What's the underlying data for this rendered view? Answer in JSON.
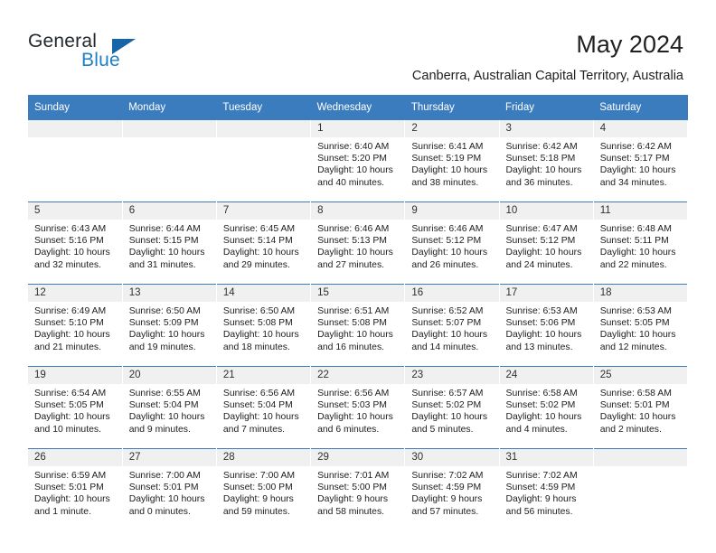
{
  "brand": {
    "word_one": "General",
    "word_two": "Blue",
    "triangle_icon": "triangle-icon",
    "accent_color": "#1f7fc4",
    "header_color": "#3b7cbf"
  },
  "header": {
    "title": "May 2024",
    "subtitle": "Canberra, Australian Capital Territory, Australia"
  },
  "calendar": {
    "weekday_headers": [
      "Sunday",
      "Monday",
      "Tuesday",
      "Wednesday",
      "Thursday",
      "Friday",
      "Saturday"
    ],
    "labels": {
      "sunrise": "Sunrise:",
      "sunset": "Sunset:",
      "daylight": "Daylight:"
    },
    "weeks": [
      [
        {
          "day": "",
          "empty": true
        },
        {
          "day": "",
          "empty": true
        },
        {
          "day": "",
          "empty": true
        },
        {
          "day": "1",
          "sunrise": "Sunrise: 6:40 AM",
          "sunset": "Sunset: 5:20 PM",
          "daylight": "Daylight: 10 hours and 40 minutes."
        },
        {
          "day": "2",
          "sunrise": "Sunrise: 6:41 AM",
          "sunset": "Sunset: 5:19 PM",
          "daylight": "Daylight: 10 hours and 38 minutes."
        },
        {
          "day": "3",
          "sunrise": "Sunrise: 6:42 AM",
          "sunset": "Sunset: 5:18 PM",
          "daylight": "Daylight: 10 hours and 36 minutes."
        },
        {
          "day": "4",
          "sunrise": "Sunrise: 6:42 AM",
          "sunset": "Sunset: 5:17 PM",
          "daylight": "Daylight: 10 hours and 34 minutes."
        }
      ],
      [
        {
          "day": "5",
          "sunrise": "Sunrise: 6:43 AM",
          "sunset": "Sunset: 5:16 PM",
          "daylight": "Daylight: 10 hours and 32 minutes."
        },
        {
          "day": "6",
          "sunrise": "Sunrise: 6:44 AM",
          "sunset": "Sunset: 5:15 PM",
          "daylight": "Daylight: 10 hours and 31 minutes."
        },
        {
          "day": "7",
          "sunrise": "Sunrise: 6:45 AM",
          "sunset": "Sunset: 5:14 PM",
          "daylight": "Daylight: 10 hours and 29 minutes."
        },
        {
          "day": "8",
          "sunrise": "Sunrise: 6:46 AM",
          "sunset": "Sunset: 5:13 PM",
          "daylight": "Daylight: 10 hours and 27 minutes."
        },
        {
          "day": "9",
          "sunrise": "Sunrise: 6:46 AM",
          "sunset": "Sunset: 5:12 PM",
          "daylight": "Daylight: 10 hours and 26 minutes."
        },
        {
          "day": "10",
          "sunrise": "Sunrise: 6:47 AM",
          "sunset": "Sunset: 5:12 PM",
          "daylight": "Daylight: 10 hours and 24 minutes."
        },
        {
          "day": "11",
          "sunrise": "Sunrise: 6:48 AM",
          "sunset": "Sunset: 5:11 PM",
          "daylight": "Daylight: 10 hours and 22 minutes."
        }
      ],
      [
        {
          "day": "12",
          "sunrise": "Sunrise: 6:49 AM",
          "sunset": "Sunset: 5:10 PM",
          "daylight": "Daylight: 10 hours and 21 minutes."
        },
        {
          "day": "13",
          "sunrise": "Sunrise: 6:50 AM",
          "sunset": "Sunset: 5:09 PM",
          "daylight": "Daylight: 10 hours and 19 minutes."
        },
        {
          "day": "14",
          "sunrise": "Sunrise: 6:50 AM",
          "sunset": "Sunset: 5:08 PM",
          "daylight": "Daylight: 10 hours and 18 minutes."
        },
        {
          "day": "15",
          "sunrise": "Sunrise: 6:51 AM",
          "sunset": "Sunset: 5:08 PM",
          "daylight": "Daylight: 10 hours and 16 minutes."
        },
        {
          "day": "16",
          "sunrise": "Sunrise: 6:52 AM",
          "sunset": "Sunset: 5:07 PM",
          "daylight": "Daylight: 10 hours and 14 minutes."
        },
        {
          "day": "17",
          "sunrise": "Sunrise: 6:53 AM",
          "sunset": "Sunset: 5:06 PM",
          "daylight": "Daylight: 10 hours and 13 minutes."
        },
        {
          "day": "18",
          "sunrise": "Sunrise: 6:53 AM",
          "sunset": "Sunset: 5:05 PM",
          "daylight": "Daylight: 10 hours and 12 minutes."
        }
      ],
      [
        {
          "day": "19",
          "sunrise": "Sunrise: 6:54 AM",
          "sunset": "Sunset: 5:05 PM",
          "daylight": "Daylight: 10 hours and 10 minutes."
        },
        {
          "day": "20",
          "sunrise": "Sunrise: 6:55 AM",
          "sunset": "Sunset: 5:04 PM",
          "daylight": "Daylight: 10 hours and 9 minutes."
        },
        {
          "day": "21",
          "sunrise": "Sunrise: 6:56 AM",
          "sunset": "Sunset: 5:04 PM",
          "daylight": "Daylight: 10 hours and 7 minutes."
        },
        {
          "day": "22",
          "sunrise": "Sunrise: 6:56 AM",
          "sunset": "Sunset: 5:03 PM",
          "daylight": "Daylight: 10 hours and 6 minutes."
        },
        {
          "day": "23",
          "sunrise": "Sunrise: 6:57 AM",
          "sunset": "Sunset: 5:02 PM",
          "daylight": "Daylight: 10 hours and 5 minutes."
        },
        {
          "day": "24",
          "sunrise": "Sunrise: 6:58 AM",
          "sunset": "Sunset: 5:02 PM",
          "daylight": "Daylight: 10 hours and 4 minutes."
        },
        {
          "day": "25",
          "sunrise": "Sunrise: 6:58 AM",
          "sunset": "Sunset: 5:01 PM",
          "daylight": "Daylight: 10 hours and 2 minutes."
        }
      ],
      [
        {
          "day": "26",
          "sunrise": "Sunrise: 6:59 AM",
          "sunset": "Sunset: 5:01 PM",
          "daylight": "Daylight: 10 hours and 1 minute."
        },
        {
          "day": "27",
          "sunrise": "Sunrise: 7:00 AM",
          "sunset": "Sunset: 5:01 PM",
          "daylight": "Daylight: 10 hours and 0 minutes."
        },
        {
          "day": "28",
          "sunrise": "Sunrise: 7:00 AM",
          "sunset": "Sunset: 5:00 PM",
          "daylight": "Daylight: 9 hours and 59 minutes."
        },
        {
          "day": "29",
          "sunrise": "Sunrise: 7:01 AM",
          "sunset": "Sunset: 5:00 PM",
          "daylight": "Daylight: 9 hours and 58 minutes."
        },
        {
          "day": "30",
          "sunrise": "Sunrise: 7:02 AM",
          "sunset": "Sunset: 4:59 PM",
          "daylight": "Daylight: 9 hours and 57 minutes."
        },
        {
          "day": "31",
          "sunrise": "Sunrise: 7:02 AM",
          "sunset": "Sunset: 4:59 PM",
          "daylight": "Daylight: 9 hours and 56 minutes."
        },
        {
          "day": "",
          "empty": true
        }
      ]
    ]
  }
}
